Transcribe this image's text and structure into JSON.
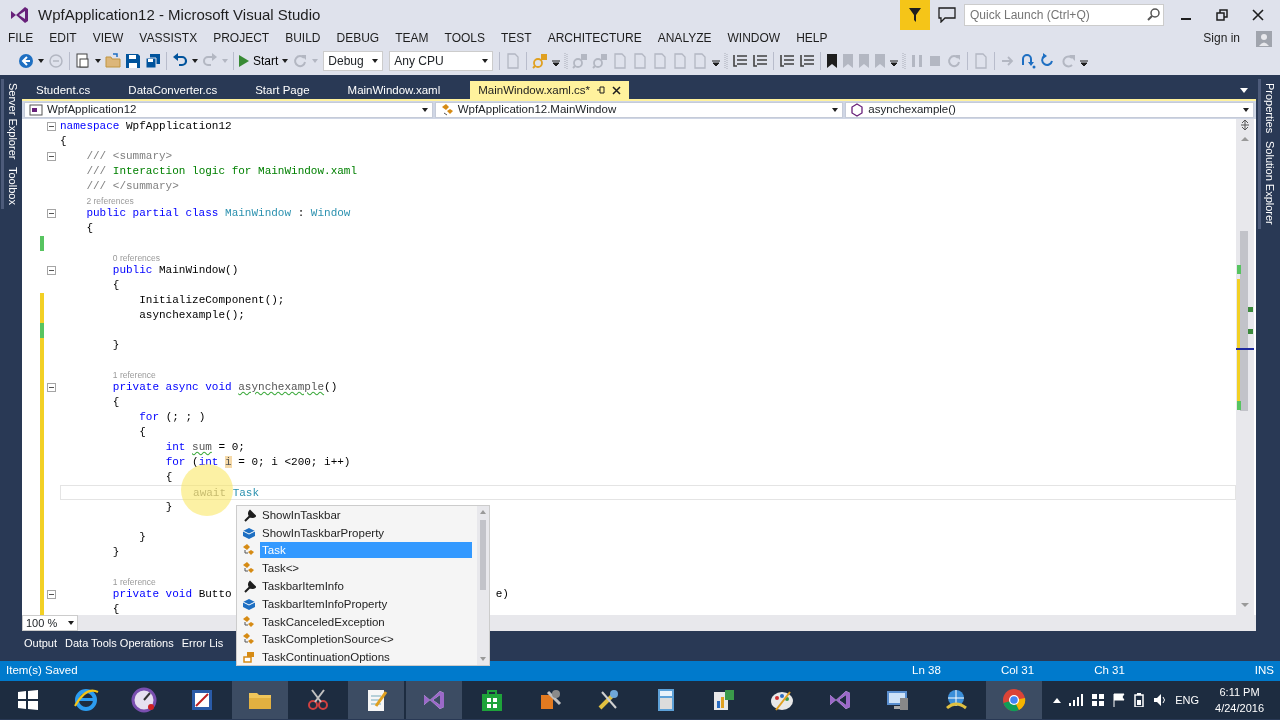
{
  "window": {
    "title": "WpfApplication12 - Microsoft Visual Studio"
  },
  "quick_launch": {
    "placeholder": "Quick Launch (Ctrl+Q)"
  },
  "menu": [
    "FILE",
    "EDIT",
    "VIEW",
    "VASSISTX",
    "PROJECT",
    "BUILD",
    "DEBUG",
    "TEAM",
    "TOOLS",
    "TEST",
    "ARCHITECTURE",
    "ANALYZE",
    "WINDOW",
    "HELP"
  ],
  "sign_in": "Sign in",
  "toolbar": [
    {
      "kind": "back",
      "disabled": false
    },
    {
      "kind": "caret",
      "disabled": false
    },
    {
      "kind": "forward",
      "disabled": true
    },
    {
      "kind": "sep"
    },
    {
      "kind": "new_project",
      "disabled": false
    },
    {
      "kind": "caret",
      "disabled": false
    },
    {
      "kind": "open",
      "disabled": false
    },
    {
      "kind": "save",
      "disabled": false
    },
    {
      "kind": "save_all",
      "disabled": false
    },
    {
      "kind": "sep"
    },
    {
      "kind": "undo",
      "disabled": false
    },
    {
      "kind": "caret",
      "disabled": false
    },
    {
      "kind": "redo",
      "disabled": true
    },
    {
      "kind": "caret",
      "disabled": true
    },
    {
      "kind": "sep"
    },
    {
      "kind": "start",
      "label": "Start"
    },
    {
      "kind": "caret",
      "disabled": false
    },
    {
      "kind": "restart",
      "disabled": true
    },
    {
      "kind": "caret",
      "disabled": true
    },
    {
      "kind": "combo",
      "value": "Debug"
    },
    {
      "kind": "combo",
      "value": "Any CPU"
    },
    {
      "kind": "sep"
    },
    {
      "kind": "document",
      "disabled": true
    },
    {
      "kind": "sep"
    },
    {
      "kind": "find",
      "disabled": false
    },
    {
      "kind": "overflow",
      "disabled": false
    },
    {
      "kind": "grip"
    },
    {
      "kind": "find",
      "disabled": true
    },
    {
      "kind": "find",
      "disabled": true
    },
    {
      "kind": "document",
      "disabled": true
    },
    {
      "kind": "document",
      "disabled": true
    },
    {
      "kind": "document",
      "disabled": true
    },
    {
      "kind": "document",
      "disabled": true
    },
    {
      "kind": "document",
      "disabled": true
    },
    {
      "kind": "overflow",
      "disabled": false
    },
    {
      "kind": "grip"
    },
    {
      "kind": "indent",
      "disabled": false
    },
    {
      "kind": "indent",
      "disabled": false
    },
    {
      "kind": "sep"
    },
    {
      "kind": "indent",
      "disabled": false
    },
    {
      "kind": "indent",
      "disabled": false
    },
    {
      "kind": "sep"
    },
    {
      "kind": "bookmark",
      "disabled": false
    },
    {
      "kind": "bookmark",
      "disabled": true
    },
    {
      "kind": "bookmark",
      "disabled": true
    },
    {
      "kind": "bookmark",
      "disabled": true
    },
    {
      "kind": "overflow",
      "disabled": false
    },
    {
      "kind": "grip"
    },
    {
      "kind": "pause",
      "disabled": true
    },
    {
      "kind": "stop",
      "disabled": true
    },
    {
      "kind": "restart",
      "disabled": true
    },
    {
      "kind": "sep"
    },
    {
      "kind": "document",
      "disabled": true
    },
    {
      "kind": "sep"
    },
    {
      "kind": "arrow",
      "disabled": true
    },
    {
      "kind": "step_over",
      "disabled": false
    },
    {
      "kind": "step_into",
      "disabled": false
    },
    {
      "kind": "step_out",
      "disabled": true
    },
    {
      "kind": "overflow",
      "disabled": false
    }
  ],
  "side_tabs_left": [
    "Server Explorer",
    "Toolbox"
  ],
  "side_tabs_right": [
    "Properties",
    "Solution Explorer"
  ],
  "document_tabs": [
    {
      "label": "Student.cs",
      "selected": false
    },
    {
      "label": "DataConverter.cs",
      "selected": false
    },
    {
      "label": "Start Page",
      "selected": false
    },
    {
      "label": "MainWindow.xaml",
      "selected": false
    },
    {
      "label": "MainWindow.xaml.cs*",
      "selected": true
    }
  ],
  "navigation": [
    {
      "kind": "project",
      "text": "WpfApplication12"
    },
    {
      "kind": "class",
      "text": "WpfApplication12.MainWindow"
    },
    {
      "kind": "method",
      "text": "asynchexample()"
    }
  ],
  "code_lines": [
    {
      "kind": "code",
      "expanded": true,
      "tokens": [
        {
          "kind": "keyword",
          "text": "namespace"
        },
        {
          "kind": "plain",
          "text": " WpfApplication12"
        }
      ]
    },
    {
      "kind": "code",
      "tokens": [
        {
          "kind": "plain",
          "text": "{"
        }
      ]
    },
    {
      "kind": "code",
      "expanded": true,
      "tokens": [
        {
          "kind": "doc",
          "text": "    /// <summary>"
        }
      ]
    },
    {
      "kind": "code",
      "tokens": [
        {
          "kind": "doc",
          "text": "    /// "
        },
        {
          "kind": "comment",
          "text": "Interaction logic for MainWindow.xaml"
        }
      ]
    },
    {
      "kind": "code",
      "tokens": [
        {
          "kind": "doc",
          "text": "    /// </summary>"
        }
      ]
    },
    {
      "kind": "lens",
      "tokens": [
        {
          "kind": "lens",
          "text": "    2 references"
        }
      ]
    },
    {
      "kind": "code",
      "expanded": true,
      "tokens": [
        {
          "kind": "keyword",
          "text": "    public partial class "
        },
        {
          "kind": "type",
          "text": "MainWindow"
        },
        {
          "kind": "plain",
          "text": " : "
        },
        {
          "kind": "type",
          "text": "Window"
        }
      ]
    },
    {
      "kind": "code",
      "tokens": [
        {
          "kind": "plain",
          "text": "    {"
        }
      ]
    },
    {
      "kind": "code",
      "color": "#57c460"
    },
    {
      "kind": "lens",
      "tokens": [
        {
          "kind": "lens",
          "text": "        0 references"
        }
      ]
    },
    {
      "kind": "code",
      "expanded": true,
      "tokens": [
        {
          "kind": "keyword",
          "text": "        public"
        },
        {
          "kind": "plain",
          "text": " MainWindow()"
        }
      ]
    },
    {
      "kind": "code",
      "tokens": [
        {
          "kind": "plain",
          "text": "        {"
        }
      ]
    },
    {
      "kind": "code",
      "color": "#f2d025",
      "tokens": [
        {
          "kind": "plain",
          "text": "            InitializeComponent();"
        }
      ]
    },
    {
      "kind": "code",
      "color": "#f2d025",
      "tokens": [
        {
          "kind": "plain",
          "text": "            asynchexample();"
        }
      ]
    },
    {
      "kind": "code",
      "color": "#57c460"
    },
    {
      "kind": "code",
      "color": "#f2d025",
      "tokens": [
        {
          "kind": "plain",
          "text": "        }"
        }
      ]
    },
    {
      "kind": "code",
      "color": "#f2d025"
    },
    {
      "kind": "lens",
      "color": "#f2d025",
      "tokens": [
        {
          "kind": "lens",
          "text": "        1 reference"
        }
      ]
    },
    {
      "kind": "code",
      "color": "#f2d025",
      "expanded": true,
      "tokens": [
        {
          "kind": "keyword",
          "text": "        private async void "
        },
        {
          "kind": "warning",
          "text": "asynchexample"
        },
        {
          "kind": "plain",
          "text": "()"
        }
      ]
    },
    {
      "kind": "code",
      "color": "#f2d025",
      "tokens": [
        {
          "kind": "plain",
          "text": "        {"
        }
      ]
    },
    {
      "kind": "code",
      "color": "#f2d025",
      "tokens": [
        {
          "kind": "keyword",
          "text": "            for"
        },
        {
          "kind": "plain",
          "text": " (; ; )"
        }
      ]
    },
    {
      "kind": "code",
      "color": "#f2d025",
      "tokens": [
        {
          "kind": "plain",
          "text": "            {"
        }
      ]
    },
    {
      "kind": "code",
      "color": "#f2d025",
      "tokens": [
        {
          "kind": "keyword",
          "text": "                int "
        },
        {
          "kind": "warning",
          "text": "sum"
        },
        {
          "kind": "plain",
          "text": " = 0;"
        }
      ]
    },
    {
      "kind": "code",
      "color": "#f2d025",
      "tokens": [
        {
          "kind": "keyword",
          "text": "                for"
        },
        {
          "kind": "plain",
          "text": " ("
        },
        {
          "kind": "keyword",
          "text": "int "
        },
        {
          "kind": "highlight",
          "text": "i"
        },
        {
          "kind": "plain",
          "text": " = 0; i <200; i++)"
        }
      ]
    },
    {
      "kind": "code",
      "color": "#f2d025",
      "tokens": [
        {
          "kind": "plain",
          "text": "                {"
        }
      ]
    },
    {
      "kind": "code",
      "color": "#f2d025",
      "current": true,
      "tokens": [
        {
          "kind": "dim",
          "text": "                    await "
        },
        {
          "kind": "type",
          "text": "Task"
        }
      ]
    },
    {
      "kind": "code",
      "color": "#f2d025",
      "tokens": [
        {
          "kind": "plain",
          "text": "                }"
        }
      ]
    },
    {
      "kind": "code",
      "color": "#f2d025"
    },
    {
      "kind": "code",
      "color": "#f2d025",
      "tokens": [
        {
          "kind": "plain",
          "text": "            }"
        }
      ]
    },
    {
      "kind": "code",
      "color": "#f2d025",
      "tokens": [
        {
          "kind": "plain",
          "text": "        }"
        }
      ]
    },
    {
      "kind": "code",
      "color": "#f2d025"
    },
    {
      "kind": "lens",
      "color": "#f2d025",
      "tokens": [
        {
          "kind": "lens",
          "text": "        1 reference"
        }
      ]
    },
    {
      "kind": "code",
      "color": "#f2d025",
      "expanded": true,
      "tokens": [
        {
          "kind": "keyword",
          "text": "        private void "
        },
        {
          "kind": "plain",
          "text": "Butto"
        }
      ],
      "tail": [
        "                                        e)"
      ]
    },
    {
      "kind": "code",
      "color": "#f2d025",
      "tokens": [
        {
          "kind": "plain",
          "text": "        {"
        }
      ]
    }
  ],
  "zoom": "100 %",
  "completion": [
    {
      "kind": "property",
      "label": "ShowInTaskbar",
      "selected": false
    },
    {
      "kind": "field",
      "label": "ShowInTaskbarProperty",
      "selected": false
    },
    {
      "kind": "class",
      "label": "Task",
      "selected": true
    },
    {
      "kind": "class",
      "label": "Task<>",
      "selected": false
    },
    {
      "kind": "property",
      "label": "TaskbarItemInfo",
      "selected": false
    },
    {
      "kind": "field",
      "label": "TaskbarItemInfoProperty",
      "selected": false
    },
    {
      "kind": "class",
      "label": "TaskCanceledException",
      "selected": false
    },
    {
      "kind": "class",
      "label": "TaskCompletionSource<>",
      "selected": false
    },
    {
      "kind": "enum",
      "label": "TaskContinuationOptions",
      "selected": false
    }
  ],
  "tool_tabs": [
    "Output",
    "Data Tools Operations",
    "Error Lis"
  ],
  "status_bar": {
    "message": "Item(s) Saved",
    "line": "Ln 38",
    "column": "Col 31",
    "char": "Ch 31",
    "mode": "INS"
  },
  "taskbar": {
    "apps": [
      {
        "kind": "windows",
        "active": false
      },
      {
        "kind": "browser",
        "active": false
      },
      {
        "kind": "gauge",
        "active": false
      },
      {
        "kind": "paint",
        "active": false
      },
      {
        "kind": "folder",
        "active": true
      },
      {
        "kind": "scissors",
        "active": false
      },
      {
        "kind": "notepad",
        "active": true
      },
      {
        "kind": "vs",
        "active": true
      },
      {
        "kind": "store",
        "active": false
      },
      {
        "kind": "tools",
        "active": false
      },
      {
        "kind": "wrench",
        "active": false
      },
      {
        "kind": "calculator",
        "active": false
      },
      {
        "kind": "chart",
        "active": false
      },
      {
        "kind": "palette",
        "active": false
      },
      {
        "kind": "vs",
        "active": false
      },
      {
        "kind": "monitor",
        "active": false
      },
      {
        "kind": "globe",
        "active": false
      },
      {
        "kind": "chrome",
        "active": true
      }
    ],
    "language": "ENG",
    "time": "6:11 PM",
    "date": "4/24/2016"
  }
}
